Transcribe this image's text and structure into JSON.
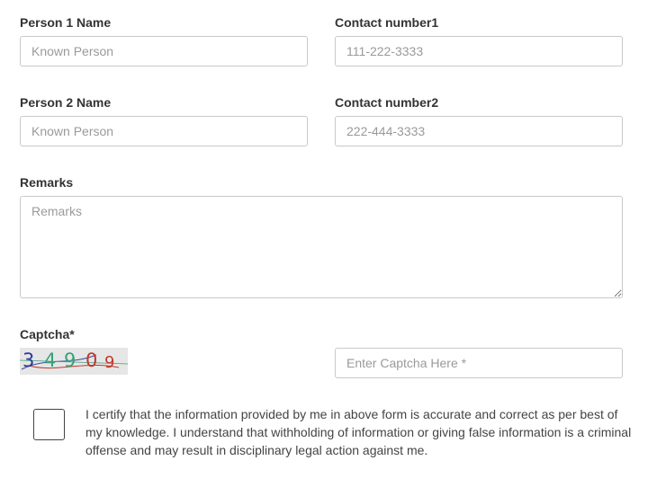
{
  "form": {
    "person1": {
      "label": "Person 1 Name",
      "placeholder": "Known Person",
      "value": ""
    },
    "contact1": {
      "label": "Contact number1",
      "placeholder": "111-222-3333",
      "value": ""
    },
    "person2": {
      "label": "Person 2 Name",
      "placeholder": "Known Person",
      "value": ""
    },
    "contact2": {
      "label": "Contact number2",
      "placeholder": "222-444-3333",
      "value": ""
    },
    "remarks": {
      "label": "Remarks",
      "placeholder": "Remarks",
      "value": ""
    },
    "captcha": {
      "label": "Captcha*",
      "image_text": [
        "3",
        "4",
        "9",
        "0",
        "9"
      ],
      "image_colors": [
        "#2b3a9a",
        "#3aa07a",
        "#3aa07a",
        "#c0392b",
        "#c0392b"
      ],
      "input_placeholder": "Enter Captcha Here *",
      "input_value": ""
    },
    "certification": {
      "checked": false,
      "text": "I certify that the information provided by me in above form is accurate and correct as per best of my knowledge. I understand that withholding of information or giving false information is a criminal offense and may result in disciplinary legal action against me."
    }
  }
}
